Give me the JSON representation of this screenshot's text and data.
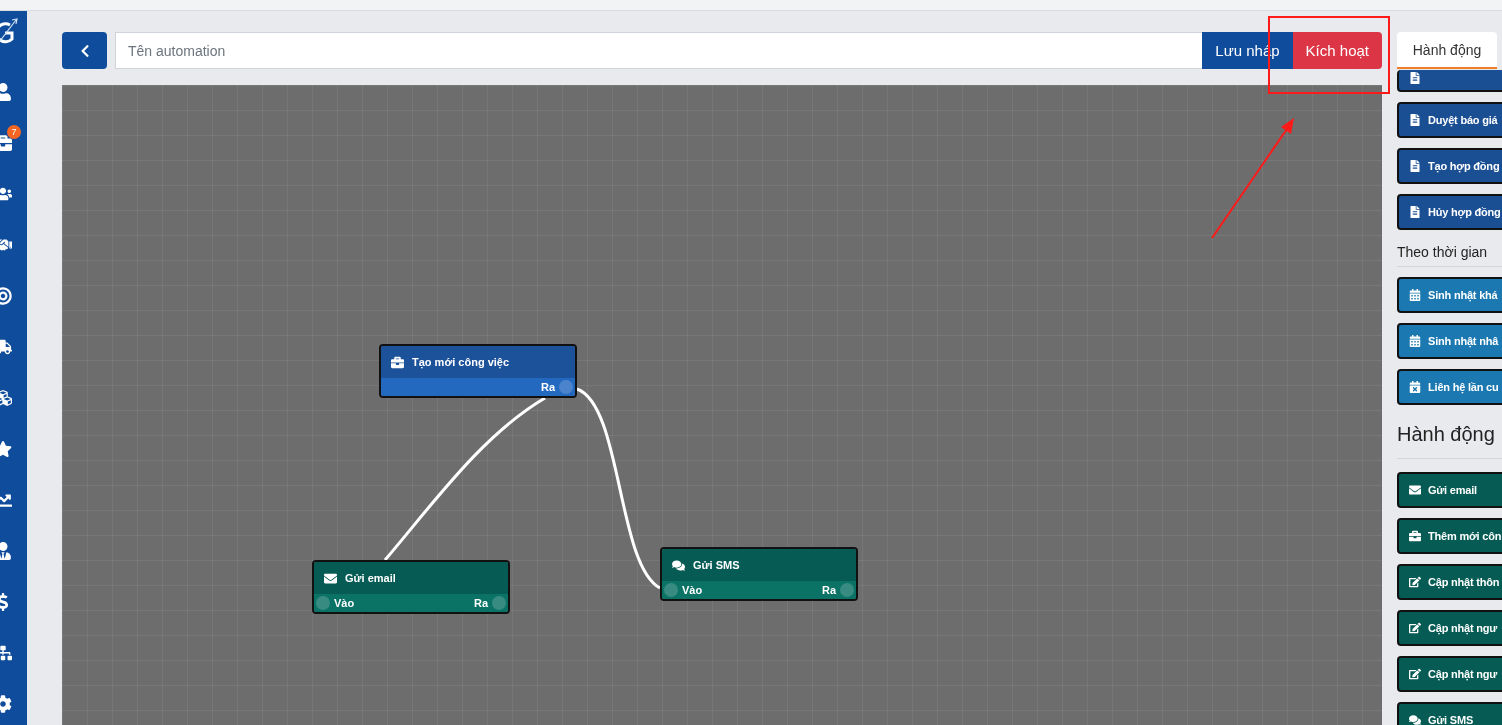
{
  "sidebar": {
    "badge": "7"
  },
  "topbar": {
    "name_field": {
      "placeholder": "Tên automation"
    },
    "buttons": [
      {
        "label": "Lưu nháp",
        "kind": "draft"
      },
      {
        "label": "Kích hoạt",
        "kind": "activate"
      }
    ]
  },
  "canvas": {
    "nodes": [
      {
        "kind": "task",
        "title": "Tạo mới công việc",
        "output_label": "Ra"
      },
      {
        "kind": "email",
        "title": "Gửi email",
        "input_label": "Vào",
        "output_label": "Ra"
      },
      {
        "kind": "sms",
        "title": "Gửi SMS",
        "input_label": "Vào",
        "output_label": "Ra"
      }
    ]
  },
  "panel": {
    "tabs": [
      {
        "label": "Hành động",
        "selected": true
      }
    ],
    "groups": [
      {
        "kind": "condition",
        "items": [
          {
            "kind": "document"
          },
          {
            "kind": "document",
            "label": "Duyệt báo giá"
          },
          {
            "kind": "document",
            "label": "Tạo hợp đồng"
          },
          {
            "kind": "document",
            "label": "Hủy hợp đồng"
          }
        ]
      },
      {
        "kind": "time",
        "heading": "Theo thời gian",
        "items": [
          {
            "kind": "calendar",
            "label": "Sinh nhật khá"
          },
          {
            "kind": "calendar",
            "label": "Sinh nhật nhâ"
          },
          {
            "kind": "overdue",
            "label": "Liên hệ lần cu"
          }
        ]
      },
      {
        "kind": "action",
        "heading": "Hành động",
        "items": [
          {
            "kind": "email",
            "label": "Gửi email"
          },
          {
            "kind": "task",
            "label": "Thêm mới côn"
          },
          {
            "kind": "update",
            "label": "Cập nhật thôn"
          },
          {
            "kind": "update",
            "label": "Cập nhật ngư"
          },
          {
            "kind": "update",
            "label": "Cập nhật ngư"
          },
          {
            "kind": "sms",
            "label": "Gửi SMS"
          }
        ]
      }
    ]
  }
}
